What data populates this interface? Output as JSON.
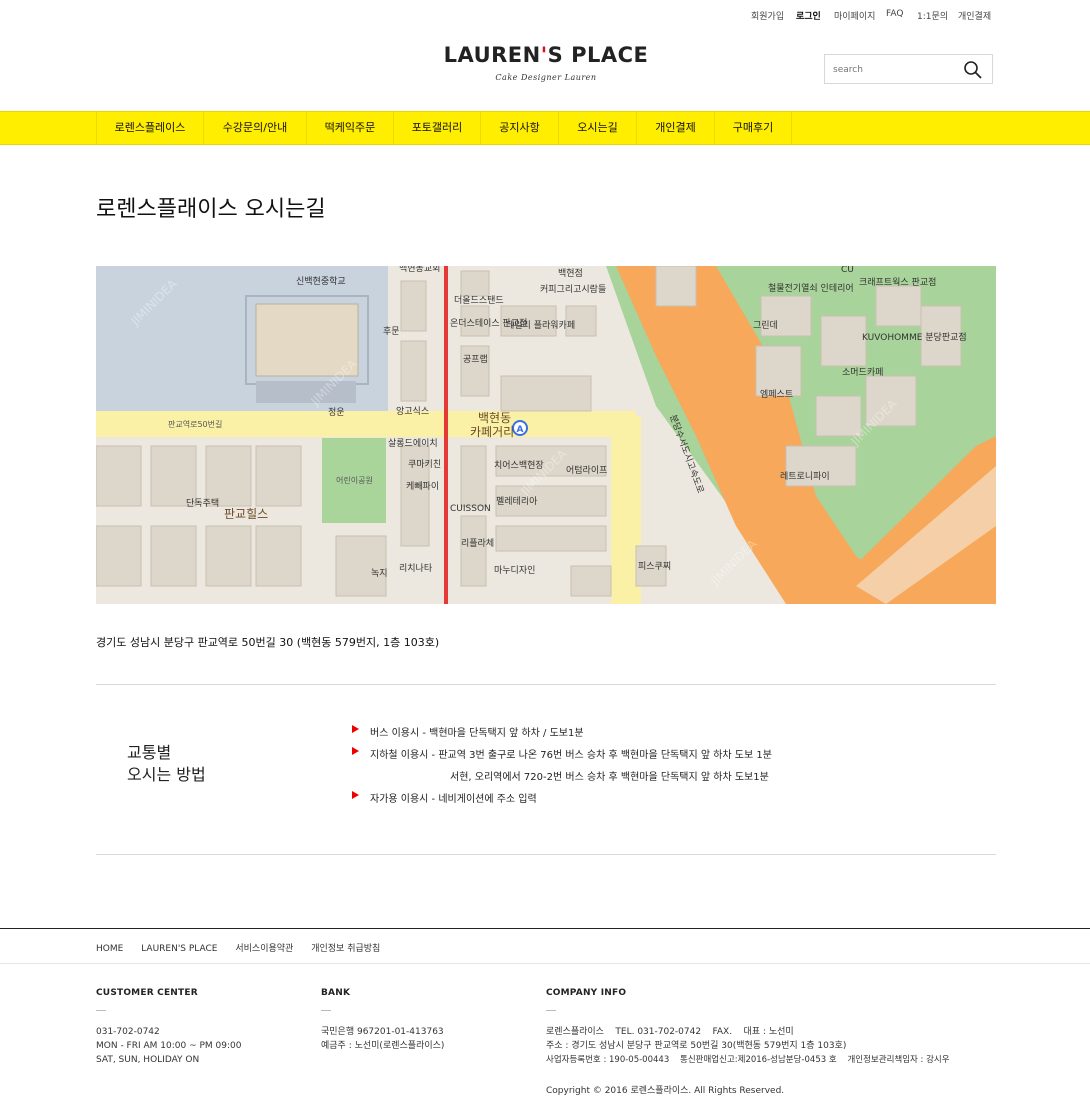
{
  "top_links": [
    {
      "label": "회원가입",
      "bold": false
    },
    {
      "label": "로그인",
      "bold": true
    },
    {
      "label": "마이페이지",
      "bold": false
    },
    {
      "label": "FAQ",
      "bold": false
    },
    {
      "label": "1:1문의",
      "bold": false
    },
    {
      "label": "개인결제",
      "bold": false
    }
  ],
  "logo": {
    "main_a": "LAUREN",
    "apos": "'",
    "main_b": "S PLACE",
    "sub": "Cake Designer Lauren"
  },
  "search": {
    "placeholder": "search"
  },
  "nav": [
    "로렌스플레이스",
    "수강문의/안내",
    "떡케익주문",
    "포토갤러리",
    "공지사항",
    "오시는길",
    "개인결제",
    "구매후기"
  ],
  "page_title": "로렌스플래이스 오시는길",
  "map": {
    "labels": [
      "신백현중학교",
      "더올드스탠드",
      "온더스테이스 판교점",
      "데일리 플라워카페",
      "공프랩",
      "백현동",
      "카페거리",
      "앙고식스",
      "살롱드에이치",
      "쿠마키친",
      "케빼파이",
      "CUISSON",
      "치어스백현장",
      "어텀라이프",
      "펠레테리아",
      "리플라체",
      "마누디자인",
      "리치나타",
      "피스쿠찌",
      "단독주택",
      "판교힐스",
      "어린이공원",
      "정운",
      "후문",
      "판교역로50번길",
      "백현동교회",
      "커피그리고시람들",
      "백현점",
      "철물전기열쇠 인테리어",
      "크래프트웍스 판교점",
      "그린데",
      "KUVOHOMME 분당판교점",
      "소머드카페",
      "엠페스트",
      "레트로니파이",
      "분당수서도시고속도로",
      "CU",
      "녹지"
    ],
    "watermark": "JIMINIDEA",
    "marker": "A"
  },
  "address": "경기도 성남시 분당구 판교역로 50번길 30 (백현동 579번지, 1층 103호)",
  "transport": {
    "title_line1": "교통별",
    "title_line2": "오시는 방법",
    "rows": [
      "버스 이용시 - 백현마을 단독택지 앞 하차 / 도보1분",
      "지하철 이용시 - 판교역  3번 출구로 나온 76번 버스 승차 후 백현마을 단독택지 앞 하차 도보 1분",
      "서현, 오리역에서 720-2번 버스 승차 후 백현마을 단독택지 앞 하차 도보1분",
      "자가용 이용시 - 네비게이션에 주소 입력"
    ]
  },
  "footer": {
    "links": [
      "HOME",
      "LAUREN'S PLACE",
      "서비스이용약관",
      "개인정보 취급방침"
    ],
    "customer": {
      "head": "CUSTOMER CENTER",
      "lines": [
        "031-702-0742",
        "MON - FRI AM 10:00 ~ PM 09:00",
        "SAT, SUN, HOLIDAY ON"
      ]
    },
    "bank": {
      "head": "BANK",
      "lines": [
        "국민은행 967201-01-413763",
        "예금주 : 노선미(로렌스플라이스)"
      ]
    },
    "company": {
      "head": "COMPANY INFO",
      "lines": [
        "로렌스플라이스    TEL. 031-702-0742    FAX.    대표 : 노선미",
        "주소 : 경기도 성남시 분당구 판교역로 50번길 30(백현동 579번지 1층 103호)",
        "사업자등록번호 : 190-05-00443    통신판매업신고:제2016-성남분당-0453 호    개인정보관리책임자 : 강시우"
      ]
    },
    "copyright": "Copyright © 2016 로렌스플라이스. All Rights Reserved."
  }
}
